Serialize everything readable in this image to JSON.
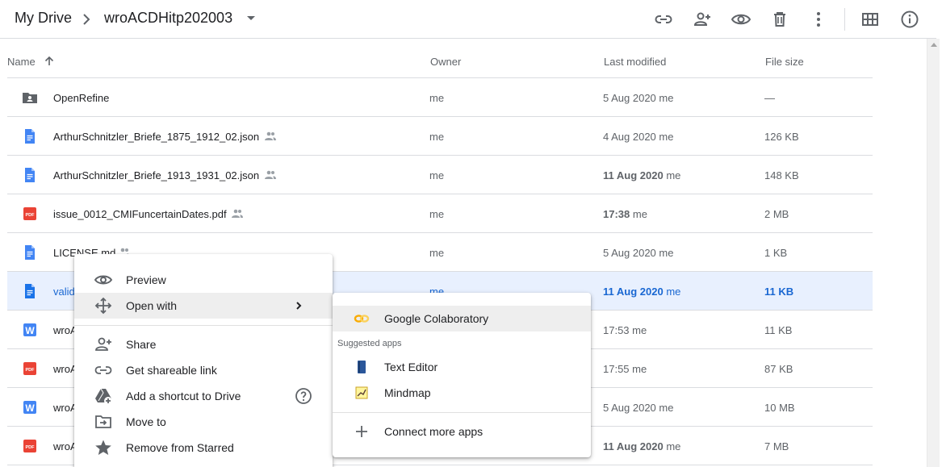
{
  "breadcrumb": {
    "root": "My Drive",
    "current": "wroACDHitp202003"
  },
  "toolbar": {
    "icons": [
      "link-icon",
      "add-person-icon",
      "preview-eye-icon",
      "trash-icon",
      "more-vert-icon",
      "grid-view-icon",
      "info-icon"
    ]
  },
  "table": {
    "headers": {
      "name": "Name",
      "owner": "Owner",
      "modified": "Last modified",
      "size": "File size"
    },
    "rows": [
      {
        "icon": "shared-folder-icon",
        "name": "OpenRefine",
        "shared": false,
        "owner": "me",
        "modified": "5 Aug 2020",
        "modified_by": "me",
        "size": "—",
        "selected": false
      },
      {
        "icon": "doc-icon",
        "name": "ArthurSchnitzler_Briefe_1875_1912_02.json",
        "shared": true,
        "owner": "me",
        "modified": "4 Aug 2020",
        "modified_by": "me",
        "size": "126 KB",
        "selected": false
      },
      {
        "icon": "doc-icon",
        "name": "ArthurSchnitzler_Briefe_1913_1931_02.json",
        "shared": true,
        "owner": "me",
        "modified": "11 Aug 2020",
        "modified_by": "me",
        "size": "148 KB",
        "selected": false
      },
      {
        "icon": "pdf-icon",
        "name": "issue_0012_CMIFuncertainDates.pdf",
        "shared": true,
        "owner": "me",
        "modified": "17:38",
        "modified_by": "me",
        "size": "2 MB",
        "selected": false
      },
      {
        "icon": "doc-icon",
        "name": "LICENSE.md",
        "shared": true,
        "owner": "me",
        "modified": "5 Aug 2020",
        "modified_by": "me",
        "size": "1 KB",
        "selected": false
      },
      {
        "icon": "doc-icon",
        "name": "valid",
        "shared": false,
        "owner": "me",
        "modified": "11 Aug 2020",
        "modified_by": "me",
        "size": "11 KB",
        "selected": true
      },
      {
        "icon": "word-icon",
        "name": "wroA",
        "shared": false,
        "owner": "",
        "modified": "17:53",
        "modified_by": "me",
        "size": "11 KB",
        "selected": false
      },
      {
        "icon": "pdf-icon",
        "name": "wroA",
        "shared": false,
        "owner": "",
        "modified": "17:55",
        "modified_by": "me",
        "size": "87 KB",
        "selected": false
      },
      {
        "icon": "word-icon",
        "name": "wroA",
        "shared": false,
        "owner": "",
        "modified": "5 Aug 2020",
        "modified_by": "me",
        "size": "10 MB",
        "selected": false
      },
      {
        "icon": "pdf-icon",
        "name": "wroA",
        "shared": false,
        "owner": "",
        "modified": "11 Aug 2020",
        "modified_by": "me",
        "size": "7 MB",
        "selected": false
      }
    ]
  },
  "context_menu": {
    "items": [
      {
        "label": "Preview",
        "icon": "eye-icon"
      },
      {
        "label": "Open with",
        "icon": "move-arrows-icon",
        "has_submenu": true
      },
      {
        "label": "Share",
        "icon": "add-person-icon"
      },
      {
        "label": "Get shareable link",
        "icon": "link-icon"
      },
      {
        "label": "Add a shortcut to Drive",
        "icon": "drive-shortcut-icon",
        "help": true
      },
      {
        "label": "Move to",
        "icon": "move-to-folder-icon"
      },
      {
        "label": "Remove from Starred",
        "icon": "star-icon"
      }
    ]
  },
  "open_with_menu": {
    "primary": "Google Colaboratory",
    "suggested_caption": "Suggested apps",
    "suggested": [
      "Text Editor",
      "Mindmap"
    ],
    "connect": "Connect more apps"
  },
  "colors": {
    "accent": "#1a73e8",
    "selected_bg": "#e8f0fe",
    "pdf_red": "#ea4335",
    "doc_blue": "#4285f4",
    "word_blue": "#2b579a"
  }
}
